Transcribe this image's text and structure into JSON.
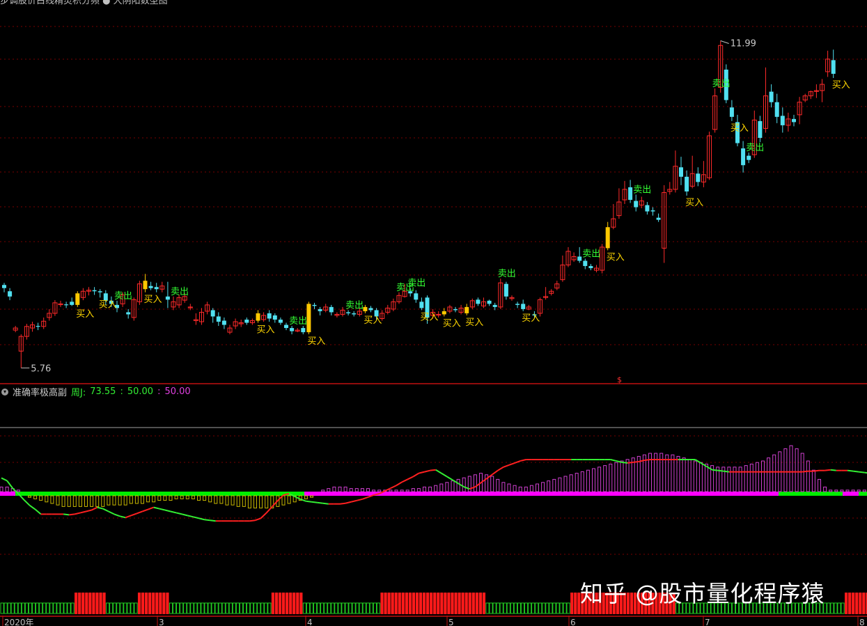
{
  "header": {
    "top_title": "步调股价白线精灵积分频 ● 大阴阳数型图",
    "indicator_name": "准确率极高副",
    "indicator_values": {
      "label": "周J:",
      "v1": "73.55",
      "v2": "50.00",
      "v3": "50.00"
    }
  },
  "price_labels": {
    "high": "11.99",
    "low": "5.76"
  },
  "marker": "$",
  "signal_labels": {
    "buy": "买入",
    "sell": "卖出"
  },
  "x_axis": [
    "2020年",
    "3",
    "4",
    "5",
    "6",
    "7",
    "8"
  ],
  "watermark": "知乎 @股市量化程序猿",
  "colors": {
    "up": "#ff2a2a",
    "down": "#50e0f0",
    "signal_candle": "#ffc800",
    "buy_text": "#ffd700",
    "sell_text": "#33ff33",
    "grid": "#7a0000",
    "line_up": "#ff2020",
    "line_down": "#33ee33",
    "hist_pos": "#d040d0",
    "hist_neg": "#c8b800",
    "zero_green": "#00ee00",
    "zero_magenta": "#ff00ff"
  },
  "chart_data": {
    "type": "candlestick",
    "ylim": [
      5.5,
      12.5
    ],
    "high": 11.99,
    "low": 5.76,
    "candles": [
      [
        7.34,
        7.28,
        7.38,
        7.2
      ],
      [
        7.22,
        7.12,
        7.28,
        7.05
      ],
      [
        6.48,
        6.52,
        6.56,
        6.44
      ],
      [
        6.08,
        6.36,
        6.4,
        5.76
      ],
      [
        6.36,
        6.55,
        6.6,
        6.3
      ],
      [
        6.52,
        6.58,
        6.64,
        6.45
      ],
      [
        6.56,
        6.55,
        6.62,
        6.48
      ],
      [
        6.55,
        6.65,
        6.72,
        6.5
      ],
      [
        6.72,
        6.8,
        6.88,
        6.66
      ],
      [
        6.8,
        7.0,
        7.05,
        6.75
      ],
      [
        6.98,
        6.98,
        7.04,
        6.92
      ],
      [
        6.97,
        6.96,
        7.02,
        6.9
      ],
      [
        7.02,
        6.96,
        7.1,
        6.94
      ],
      [
        6.96,
        7.18,
        7.22,
        6.92
      ],
      [
        7.1,
        7.22,
        7.28,
        7.05
      ],
      [
        7.22,
        7.24,
        7.3,
        7.14
      ],
      [
        7.24,
        7.22,
        7.3,
        7.15
      ],
      [
        7.22,
        7.2,
        7.26,
        7.1
      ],
      [
        7.18,
        7.04,
        7.24,
        6.96
      ],
      [
        7.04,
        6.98,
        7.12,
        6.92
      ],
      [
        6.96,
        6.9,
        7.04,
        6.82
      ],
      [
        6.98,
        7.15,
        7.2,
        6.92
      ],
      [
        6.82,
        6.78,
        6.88,
        6.7
      ],
      [
        6.72,
        7.06,
        7.1,
        6.66
      ],
      [
        7.02,
        7.36,
        7.42,
        6.96
      ],
      [
        7.26,
        7.42,
        7.55,
        7.2
      ],
      [
        7.32,
        7.28,
        7.4,
        7.24
      ],
      [
        7.3,
        7.26,
        7.38,
        7.2
      ],
      [
        7.26,
        7.32,
        7.4,
        7.2
      ],
      [
        7.12,
        7.06,
        7.4,
        6.9
      ],
      [
        6.92,
        7.02,
        7.12,
        6.86
      ],
      [
        6.96,
        7.1,
        7.16,
        6.9
      ],
      [
        7.05,
        7.12,
        7.18,
        7.0
      ],
      [
        6.92,
        6.92,
        6.98,
        6.86
      ],
      [
        6.66,
        6.68,
        6.8,
        6.58
      ],
      [
        6.64,
        6.82,
        6.9,
        6.58
      ],
      [
        6.84,
        6.96,
        7.02,
        6.78
      ],
      [
        6.86,
        6.74,
        6.9,
        6.62
      ],
      [
        6.74,
        6.64,
        6.82,
        6.56
      ],
      [
        6.66,
        6.58,
        6.72,
        6.5
      ],
      [
        6.44,
        6.52,
        6.58,
        6.4
      ],
      [
        6.56,
        6.64,
        6.7,
        6.5
      ],
      [
        6.6,
        6.62,
        6.68,
        6.54
      ],
      [
        6.68,
        6.62,
        6.72,
        6.58
      ],
      [
        6.62,
        6.66,
        6.7,
        6.58
      ],
      [
        6.66,
        6.8,
        6.86,
        6.62
      ],
      [
        6.68,
        6.76,
        6.82,
        6.64
      ],
      [
        6.8,
        6.7,
        6.86,
        6.64
      ],
      [
        6.76,
        6.68,
        6.8,
        6.62
      ],
      [
        6.68,
        6.62,
        6.72,
        6.58
      ],
      [
        6.58,
        6.52,
        6.62,
        6.48
      ],
      [
        6.52,
        6.46,
        6.56,
        6.4
      ],
      [
        6.46,
        6.48,
        6.52,
        6.44
      ],
      [
        6.52,
        6.44,
        6.56,
        6.4
      ],
      [
        6.44,
        6.98,
        7.02,
        6.4
      ],
      [
        6.96,
        6.94,
        7.0,
        6.88
      ],
      [
        6.88,
        6.84,
        6.92,
        6.76
      ],
      [
        6.86,
        6.92,
        6.98,
        6.82
      ],
      [
        6.92,
        6.82,
        6.96,
        6.76
      ],
      [
        6.76,
        6.78,
        6.82,
        6.72
      ],
      [
        6.78,
        6.86,
        6.92,
        6.74
      ],
      [
        6.82,
        6.8,
        6.86,
        6.76
      ],
      [
        6.8,
        6.78,
        6.84,
        6.74
      ],
      [
        6.78,
        6.84,
        6.9,
        6.74
      ],
      [
        6.84,
        6.92,
        6.96,
        6.8
      ],
      [
        6.9,
        6.86,
        6.94,
        6.82
      ],
      [
        6.86,
        6.74,
        6.9,
        6.68
      ],
      [
        6.7,
        6.8,
        6.86,
        6.66
      ],
      [
        6.82,
        6.9,
        6.96,
        6.78
      ],
      [
        6.88,
        7.02,
        7.08,
        6.84
      ],
      [
        7.02,
        7.14,
        7.2,
        6.98
      ],
      [
        7.12,
        7.22,
        7.36,
        7.1
      ],
      [
        7.22,
        7.18,
        7.28,
        7.12
      ],
      [
        7.18,
        7.06,
        7.24,
        7.0
      ],
      [
        7.02,
        6.9,
        7.1,
        6.86
      ],
      [
        7.1,
        6.72,
        7.14,
        6.6
      ],
      [
        6.76,
        6.82,
        6.88,
        6.7
      ],
      [
        6.78,
        6.78,
        6.84,
        6.72
      ],
      [
        6.78,
        6.84,
        6.9,
        6.74
      ],
      [
        6.84,
        6.92,
        6.96,
        6.8
      ],
      [
        6.88,
        6.86,
        6.92,
        6.82
      ],
      [
        6.82,
        6.9,
        6.96,
        6.78
      ],
      [
        6.8,
        6.92,
        6.98,
        6.76
      ],
      [
        6.92,
        7.04,
        7.08,
        6.88
      ],
      [
        7.06,
        6.98,
        7.1,
        6.94
      ],
      [
        6.94,
        7.02,
        7.1,
        6.9
      ],
      [
        7.04,
        6.98,
        7.06,
        6.94
      ],
      [
        6.96,
        6.92,
        7.0,
        6.86
      ],
      [
        6.92,
        7.38,
        7.46,
        6.88
      ],
      [
        7.36,
        7.12,
        7.4,
        7.06
      ],
      [
        7.08,
        7.1,
        7.14,
        7.04
      ],
      [
        6.98,
        6.96,
        7.02,
        6.9
      ],
      [
        6.98,
        6.88,
        7.06,
        6.84
      ],
      [
        6.88,
        6.92,
        6.96,
        6.86
      ],
      [
        6.78,
        6.76,
        6.84,
        6.72
      ],
      [
        6.8,
        7.06,
        7.1,
        6.74
      ],
      [
        7.1,
        7.12,
        7.3,
        7.06
      ],
      [
        7.18,
        7.22,
        7.26,
        7.14
      ],
      [
        7.28,
        7.36,
        7.42,
        7.24
      ],
      [
        7.44,
        7.72,
        7.9,
        7.4
      ],
      [
        7.72,
        7.98,
        8.06,
        7.68
      ],
      [
        7.82,
        7.88,
        7.96,
        7.78
      ],
      [
        7.88,
        7.8,
        8.06,
        7.76
      ],
      [
        7.8,
        7.7,
        7.84,
        7.64
      ],
      [
        7.7,
        7.66,
        7.74,
        7.62
      ],
      [
        7.62,
        7.66,
        7.72,
        7.58
      ],
      [
        7.62,
        8.06,
        8.12,
        7.56
      ],
      [
        8.04,
        8.44,
        8.54,
        8.0
      ],
      [
        8.44,
        8.6,
        8.88,
        8.4
      ],
      [
        8.66,
        8.92,
        9.18,
        8.6
      ],
      [
        8.96,
        9.16,
        9.32,
        8.88
      ],
      [
        9.2,
        8.96,
        9.34,
        8.9
      ],
      [
        8.94,
        8.82,
        9.06,
        8.74
      ],
      [
        8.86,
        8.94,
        9.02,
        8.8
      ],
      [
        8.86,
        8.74,
        8.92,
        8.68
      ],
      [
        8.76,
        8.74,
        8.82,
        8.66
      ],
      [
        8.62,
        8.58,
        8.7,
        8.54
      ],
      [
        8.04,
        9.1,
        9.24,
        7.76
      ],
      [
        9.12,
        9.16,
        9.3,
        9.06
      ],
      [
        9.16,
        9.6,
        9.9,
        9.1
      ],
      [
        9.58,
        9.4,
        9.78,
        9.24
      ],
      [
        9.4,
        9.12,
        9.52,
        9.04
      ],
      [
        9.22,
        9.46,
        9.8,
        9.18
      ],
      [
        9.46,
        9.3,
        9.58,
        9.22
      ],
      [
        9.3,
        9.44,
        9.7,
        9.2
      ],
      [
        9.38,
        10.18,
        10.26,
        9.34
      ],
      [
        10.3,
        10.94,
        11.08,
        10.24
      ],
      [
        11.1,
        11.9,
        11.99,
        11.0
      ],
      [
        11.44,
        10.86,
        11.54,
        10.8
      ],
      [
        10.72,
        10.54,
        10.86,
        10.46
      ],
      [
        10.44,
        10.04,
        10.58,
        9.98
      ],
      [
        9.94,
        9.62,
        10.08,
        9.48
      ],
      [
        9.8,
        9.72,
        9.86,
        9.66
      ],
      [
        9.82,
        10.48,
        10.66,
        9.76
      ],
      [
        10.46,
        10.14,
        10.56,
        10.06
      ],
      [
        10.32,
        10.94,
        11.48,
        10.24
      ],
      [
        11.02,
        10.82,
        11.16,
        10.72
      ],
      [
        10.82,
        10.54,
        10.98,
        10.42
      ],
      [
        10.56,
        10.38,
        10.72,
        10.24
      ],
      [
        10.38,
        10.5,
        10.62,
        10.26
      ],
      [
        10.5,
        10.44,
        10.58,
        10.36
      ],
      [
        10.58,
        10.82,
        10.92,
        10.4
      ],
      [
        10.86,
        10.94,
        10.98,
        10.82
      ],
      [
        10.94,
        11.02,
        11.04,
        10.88
      ],
      [
        11.04,
        11.04,
        11.16,
        10.9
      ],
      [
        11.04,
        11.16,
        11.26,
        10.82
      ],
      [
        11.4,
        11.64,
        11.8,
        11.3
      ],
      [
        11.62,
        11.36,
        11.82,
        11.28
      ]
    ],
    "signals": [
      {
        "bar": 13,
        "type": "buy"
      },
      {
        "bar": 17,
        "type": "buy"
      },
      {
        "bar": 20,
        "type": "sell"
      },
      {
        "bar": 25,
        "type": "buy"
      },
      {
        "bar": 30,
        "type": "sell"
      },
      {
        "bar": 45,
        "type": "buy"
      },
      {
        "bar": 51,
        "type": "sell"
      },
      {
        "bar": 54,
        "type": "buy"
      },
      {
        "bar": 61,
        "type": "sell"
      },
      {
        "bar": 64,
        "type": "buy"
      },
      {
        "bar": 70,
        "type": "sell"
      },
      {
        "bar": 72,
        "type": "sell"
      },
      {
        "bar": 74,
        "type": "buy"
      },
      {
        "bar": 78,
        "type": "buy"
      },
      {
        "bar": 82,
        "type": "buy"
      },
      {
        "bar": 88,
        "type": "sell"
      },
      {
        "bar": 92,
        "type": "buy"
      },
      {
        "bar": 103,
        "type": "sell"
      },
      {
        "bar": 107,
        "type": "buy"
      },
      {
        "bar": 112,
        "type": "sell"
      },
      {
        "bar": 121,
        "type": "buy"
      },
      {
        "bar": 126,
        "type": "sell"
      },
      {
        "bar": 129,
        "type": "buy"
      },
      {
        "bar": 132,
        "type": "sell"
      },
      {
        "bar": 147,
        "type": "buy"
      }
    ],
    "indicator": {
      "ylim": [
        0,
        100
      ],
      "zero_level": 50,
      "line": [
        73,
        69,
        58,
        50,
        41,
        33,
        27,
        20,
        20,
        20,
        20,
        20,
        19,
        20,
        22,
        24,
        26,
        30,
        28,
        24,
        20,
        17,
        15,
        18,
        21,
        24,
        27,
        30,
        28,
        26,
        24,
        22,
        20,
        18,
        16,
        14,
        12,
        11,
        10,
        10,
        10,
        10,
        10,
        10,
        10,
        11,
        14,
        22,
        31,
        40,
        48,
        50,
        46,
        42,
        39,
        38,
        37,
        36,
        35,
        35,
        35,
        36,
        38,
        40,
        42,
        45,
        48,
        50,
        54,
        58,
        62,
        67,
        71,
        75,
        80,
        82,
        84,
        85,
        80,
        75,
        70,
        65,
        60,
        57,
        60,
        66,
        72,
        78,
        84,
        89,
        92,
        95,
        98,
        101,
        104,
        107,
        111,
        114,
        117,
        121,
        125,
        128,
        126,
        122,
        118,
        114,
        110,
        106,
        102,
        98,
        96,
        95,
        96,
        97,
        99,
        102,
        106,
        112,
        118,
        124,
        129,
        122,
        112,
        102,
        95,
        90,
        85,
        84,
        83,
        82,
        82,
        82,
        82,
        82,
        82,
        82,
        82,
        82,
        82,
        82,
        82,
        82,
        82,
        83,
        83,
        84,
        84,
        85,
        84,
        84,
        84,
        83,
        82,
        81,
        80
      ],
      "hist": [
        3,
        3,
        2,
        1,
        0,
        -1,
        -2,
        -3,
        -4,
        -5,
        -6,
        -7,
        -7,
        -7,
        -7,
        -7,
        -7,
        -7,
        -7,
        -6,
        -6,
        -6,
        -6,
        -5,
        -5,
        -5,
        -4,
        -4,
        -3,
        -3,
        -3,
        -2,
        -2,
        -2,
        -2,
        -3,
        -3,
        -4,
        -5,
        -5,
        -6,
        -6,
        -7,
        -7,
        -8,
        -8,
        -8,
        -8,
        -8,
        -7,
        -6,
        -5,
        -4,
        -3,
        -2,
        -1,
        0,
        1,
        2,
        3,
        3,
        3,
        2,
        2,
        2,
        2,
        1,
        1,
        1,
        1,
        1,
        1,
        1,
        2,
        2,
        3,
        3,
        4,
        5,
        6,
        7,
        8,
        9,
        10,
        11,
        12,
        11,
        10,
        8,
        6,
        5,
        4,
        3,
        3,
        4,
        5,
        6,
        7,
        8,
        9,
        10,
        11,
        12,
        13,
        14,
        15,
        16,
        17,
        18,
        19,
        20,
        21,
        22,
        23,
        24,
        25,
        25,
        25,
        24,
        24,
        23,
        22,
        21,
        20,
        19,
        18,
        17,
        16,
        16,
        16,
        16,
        16,
        17,
        18,
        19,
        20,
        22,
        24,
        26,
        28,
        30,
        28,
        25,
        20,
        14,
        8,
        3,
        1,
        1,
        1,
        1,
        1,
        1,
        1,
        1,
        1,
        1,
        1,
        1,
        1,
        1,
        1,
        1,
        1,
        1,
        1,
        1,
        1,
        1,
        1,
        1,
        1,
        1,
        1,
        1,
        1
      ],
      "line_above": [
        73,
        72,
        69,
        60
      ],
      "bars": "000000000000000000000111111111000000000111111111000000000000000000000000000001111111110000000000000000000000111111111111111111111111111111000000000000000000000000111111111111111111111111111111000000000000000000000000000000000000000000000000111111111111"
    }
  }
}
